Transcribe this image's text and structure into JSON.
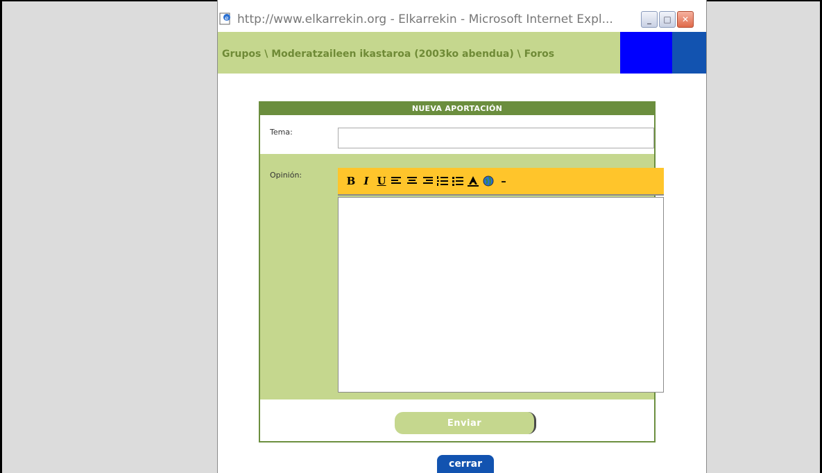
{
  "window": {
    "title": "http://www.elkarrekin.org - Elkarrekin - Microsoft Internet Expl...",
    "min_label": "_",
    "max_label": "□",
    "close_label": "✕"
  },
  "breadcrumb": {
    "text": "Grupos \\ Moderatzaileen ikastaroa (2003ko abendua) \\ Foros"
  },
  "form": {
    "header": "NUEVA APORTACIÓN",
    "tema_label": "Tema:",
    "tema_value": "",
    "opinion_label": "Opinión:",
    "opinion_value": "",
    "toolbar": {
      "bold": "B",
      "italic": "I",
      "underline": "U",
      "hr": "–"
    },
    "submit_label": "Enviar"
  },
  "footer": {
    "close_label": "cerrar"
  },
  "colors": {
    "accent_green": "#6b8e3e",
    "light_green": "#c5d78e",
    "toolbar_yellow": "#ffc52b",
    "blue": "#1253b0"
  }
}
